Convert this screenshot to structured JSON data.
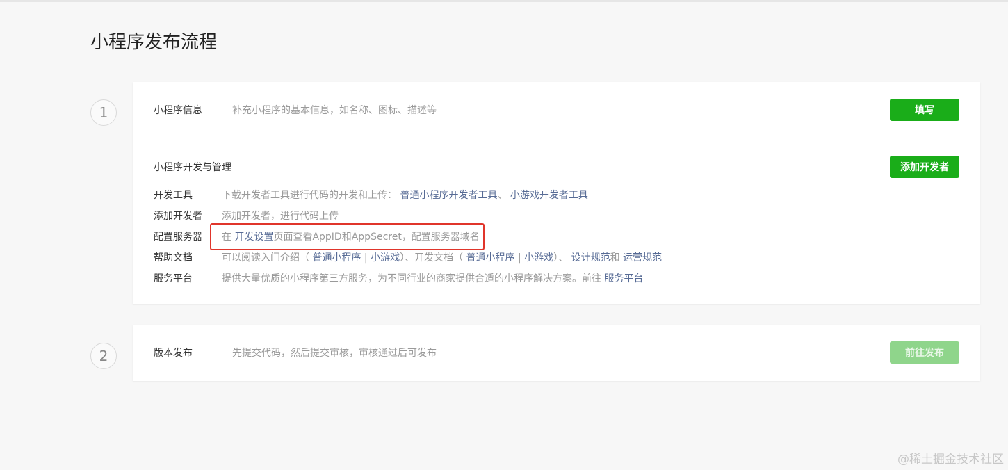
{
  "page": {
    "title": "小程序发布流程"
  },
  "steps": [
    {
      "number": "1"
    },
    {
      "number": "2"
    }
  ],
  "info": {
    "label": "小程序信息",
    "desc": "补充小程序的基本信息，如名称、图标、描述等",
    "button": "填写"
  },
  "dev": {
    "section_title": "小程序开发与管理",
    "add_dev_button": "添加开发者",
    "rows": [
      {
        "label": "开发工具",
        "desc_prefix": "下载开发者工具进行代码的开发和上传：",
        "link1": "普通小程序开发者工具",
        "sep1": "、",
        "link2": "小游戏开发者工具"
      },
      {
        "label": "添加开发者",
        "desc": "添加开发者，进行代码上传"
      },
      {
        "label": "配置服务器",
        "desc_prefix": "在",
        "link": "开发设置",
        "desc_suffix": "页面查看AppID和AppSecret，配置服务器域名"
      },
      {
        "label": "帮助文档",
        "text1": "可以阅读入门介绍（",
        "link1": "普通小程序",
        "bar1": "|",
        "link2": "小游戏",
        "text2": "）、开发文档（",
        "link3": "普通小程序",
        "bar2": "|",
        "link4": "小游戏",
        "text3": "）、",
        "link5": "设计规范",
        "text4": "和",
        "link6": "运营规范"
      },
      {
        "label": "服务平台",
        "desc_prefix": "提供大量优质的小程序第三方服务，为不同行业的商家提供合适的小程序解决方案。前往",
        "link": "服务平台"
      }
    ]
  },
  "release": {
    "label": "版本发布",
    "desc": "先提交代码，然后提交审核，审核通过后可发布",
    "button": "前往发布"
  },
  "watermark": "@稀土掘金技术社区",
  "colors": {
    "primary_green": "#1aad19",
    "disabled_green": "#8fd58b",
    "link": "#576b95",
    "highlight_red": "#e0352b"
  }
}
